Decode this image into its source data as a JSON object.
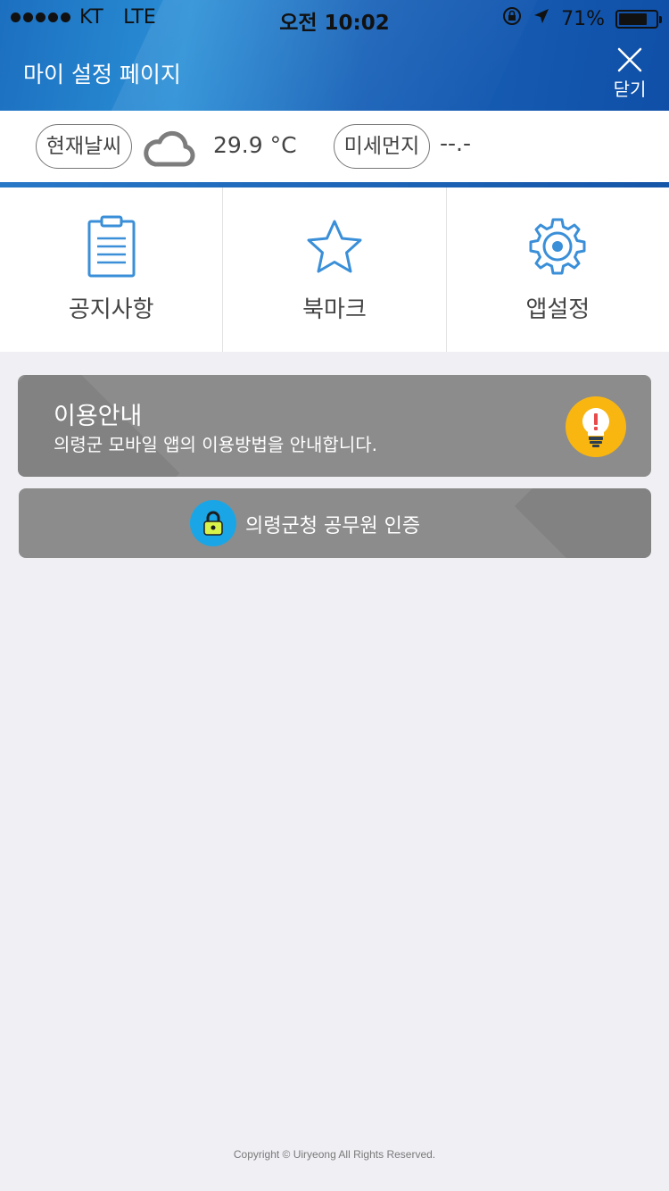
{
  "status_bar": {
    "carrier": "KT",
    "network": "LTE",
    "time": "오전 10:02",
    "battery_percent": "71%",
    "battery_level": 0.71,
    "icons": [
      "signal-dots-icon",
      "orientation-lock-icon",
      "location-arrow-icon",
      "battery-icon"
    ]
  },
  "header": {
    "title": "마이 설정 페이지",
    "close_label": "닫기",
    "colors": {
      "gradient_start": "#1c6fbf",
      "gradient_end": "#0f4fa8"
    }
  },
  "weather": {
    "weather_label": "현재날씨",
    "weather_icon": "cloud-icon",
    "temperature": "29.9 °C",
    "dust_label": "미세먼지",
    "dust_value": "--.-"
  },
  "menu": {
    "items": [
      {
        "label": "공지사항",
        "icon": "clipboard-icon"
      },
      {
        "label": "북마크",
        "icon": "star-icon"
      },
      {
        "label": "앱설정",
        "icon": "gear-icon"
      }
    ],
    "icon_color": "#3a8fd8"
  },
  "guide_card": {
    "title": "이용안내",
    "description": "의령군 모바일 앱의 이용방법을 안내합니다.",
    "icon": "lightbulb-icon",
    "icon_bg": "#f9b611"
  },
  "auth_card": {
    "label": "의령군청 공무원 인증",
    "icon": "lock-icon",
    "icon_bg": "#1aa6e6"
  },
  "footer": {
    "copyright": "Copyright © Uiryeong All Rights Reserved."
  }
}
